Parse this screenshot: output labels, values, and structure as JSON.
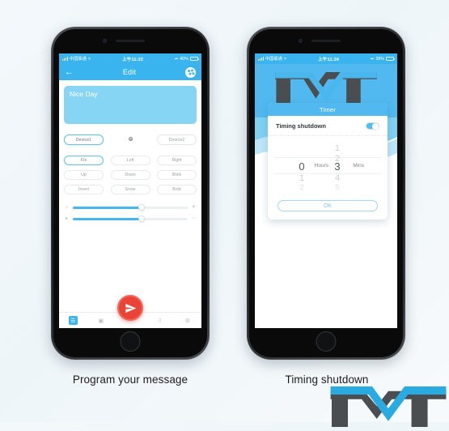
{
  "page": {
    "background_color": "#f1f7fb",
    "accent_blue": "#3ab4ef",
    "accent_red": "#ec4337",
    "logo_dark": "#4b4e50"
  },
  "left_phone": {
    "statusbar": {
      "carrier": "中国联通",
      "wifi_icon": "wifi-icon",
      "time": "上午11:22",
      "location_icon": "location-icon",
      "battery_percent": "40%"
    },
    "navbar": {
      "back_icon": "back-arrow-icon",
      "title": "Edit",
      "palette_icon": "palette-icon"
    },
    "message": {
      "text": "Nice Day",
      "placeholder": "Nice Day"
    },
    "devices": [
      {
        "label": "Device1",
        "selected": true
      },
      {
        "label": "link-icon",
        "is_icon": true
      },
      {
        "label": "Device2",
        "selected": false
      }
    ],
    "effects": [
      [
        {
          "label": "Fix",
          "selected": true
        },
        {
          "label": "Left",
          "selected": false
        },
        {
          "label": "Right",
          "selected": false
        }
      ],
      [
        {
          "label": "Up",
          "selected": false
        },
        {
          "label": "Down",
          "selected": false
        },
        {
          "label": "Blink",
          "selected": false
        }
      ],
      [
        {
          "label": "Invert",
          "selected": false
        },
        {
          "label": "Snow",
          "selected": false
        },
        {
          "label": "Bold",
          "selected": false
        }
      ]
    ],
    "sliders": [
      {
        "left_icon": "music-note-icon",
        "right_icon": "brightness-icon",
        "value": 60
      },
      {
        "left_icon": "speed-icon",
        "right_icon": "dots-icon",
        "value": 60
      }
    ],
    "tabbar": [
      {
        "icon": "text-icon",
        "active": true
      },
      {
        "icon": "image-icon",
        "active": false
      },
      {
        "icon": "music-icon",
        "active": false
      },
      {
        "icon": "gear-icon",
        "active": false
      }
    ],
    "send_button": {
      "icon": "send-paper-plane-icon"
    }
  },
  "right_phone": {
    "statusbar": {
      "carrier": "中国联通",
      "wifi_icon": "wifi-icon",
      "time": "上午11:24",
      "location_icon": "location-icon",
      "battery_percent": "38%"
    },
    "dialog": {
      "title": "Timer",
      "toggle_label": "Timing shutdown",
      "toggle_on": true,
      "hours": {
        "above2": "",
        "above1": "",
        "selected": "0",
        "below1": "1",
        "below2": "2",
        "unit": "Hours"
      },
      "mins": {
        "above2": "1",
        "above1": "2",
        "selected": "3",
        "below1": "4",
        "below2": "5",
        "unit": "Mins"
      },
      "ok_label": "OK"
    }
  },
  "captions": {
    "left": "Program your message",
    "right": "Timing shutdown"
  }
}
